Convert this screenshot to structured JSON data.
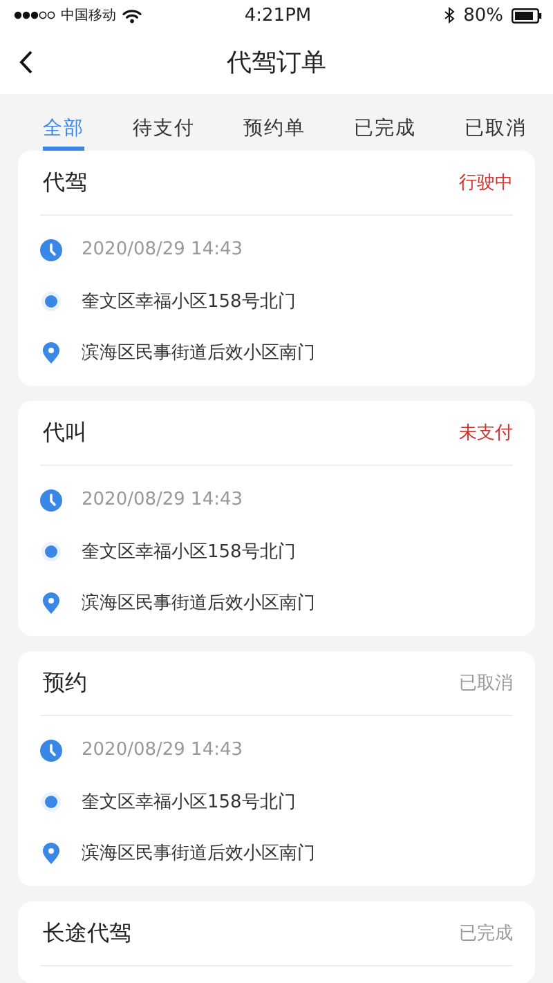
{
  "status_bar": {
    "carrier": "中国移动",
    "time": "4:21PM",
    "battery": "80%"
  },
  "nav": {
    "title": "代驾订单"
  },
  "tabs": [
    {
      "label": "全部",
      "selected": true
    },
    {
      "label": "待支付",
      "selected": false
    },
    {
      "label": "预约单",
      "selected": false
    },
    {
      "label": "已完成",
      "selected": false
    },
    {
      "label": "已取消",
      "selected": false
    }
  ],
  "orders": [
    {
      "type": "代驾",
      "status": "行驶中",
      "color": "#d0312d",
      "time": "2020/08/29  14:43",
      "from": "奎文区幸福小区158号北门",
      "to": "滨海区民事街道后效小区南门"
    },
    {
      "type": "代叫",
      "status": "未支付",
      "color": "#d0312d",
      "time": "2020/08/29  14:43",
      "from": "奎文区幸福小区158号北门",
      "to": "滨海区民事街道后效小区南门"
    },
    {
      "type": "预约",
      "status": "已取消",
      "color": "#999999",
      "time": "2020/08/29  14:43",
      "from": "奎文区幸福小区158号北门",
      "to": "滨海区民事街道后效小区南门"
    },
    {
      "type": "长途代驾",
      "status": "已完成",
      "color": "#999999"
    }
  ]
}
